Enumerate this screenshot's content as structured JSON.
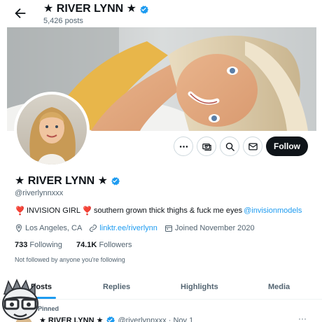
{
  "header": {
    "back_icon": "arrow-left-icon",
    "title": "★ RIVER LYNN ★",
    "post_count": "5,426 posts"
  },
  "profile": {
    "display_name": "★ RIVER LYNN ★",
    "handle": "@riverlynnxxx",
    "bio_emoji_1": "❣️",
    "bio_text_1": "INVISION GIRL",
    "bio_emoji_2": "❣️",
    "bio_text_2": "southern grown thick thighs & fuck me eyes",
    "bio_link": "@invisionmodels",
    "location": "Los Angeles, CA",
    "website": "linktr.ee/riverlynn",
    "joined": "Joined November 2020",
    "following_count": "733",
    "following_label": "Following",
    "followers_count": "74.1K",
    "followers_label": "Followers",
    "not_followed_note": "Not followed by anyone you're following"
  },
  "actions": {
    "more_icon": "more-horizontal-icon",
    "subscribe_icon": "money-icon",
    "search_icon": "search-icon",
    "message_icon": "envelope-icon",
    "follow_label": "Follow"
  },
  "tabs": [
    {
      "label": "Posts",
      "active": true
    },
    {
      "label": "Replies",
      "active": false
    },
    {
      "label": "Highlights",
      "active": false
    },
    {
      "label": "Media",
      "active": false
    }
  ],
  "pinned_tweet": {
    "pinned_label": "Pinned",
    "author": "★ RIVER LYNN ★",
    "handle_date": "@riverlynnxxx · Nov 1",
    "more_label": "···"
  },
  "colors": {
    "accent": "#1d9bf0",
    "text": "#0f1419",
    "muted": "#536471",
    "bio_heart": "#d81b3b"
  }
}
